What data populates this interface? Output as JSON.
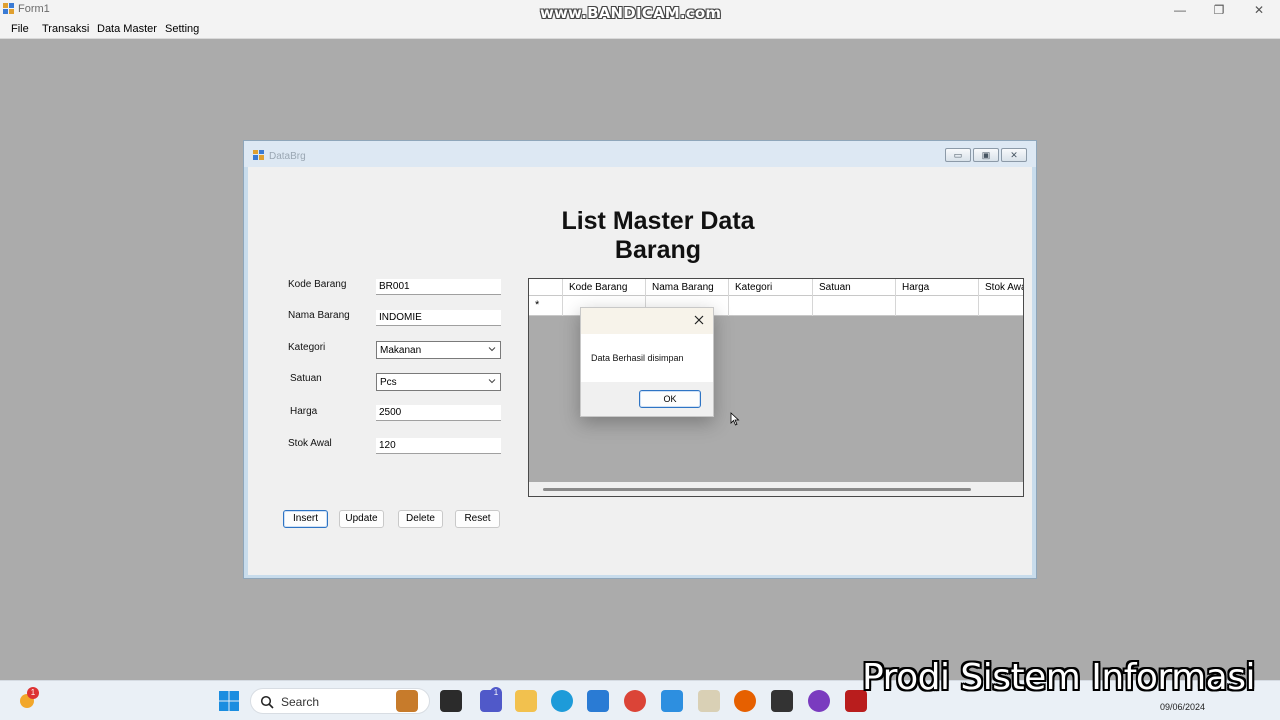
{
  "window": {
    "title": "Form1",
    "minimize": "—",
    "restore": "❐",
    "close": "✕"
  },
  "watermark": "www.BANDICAM.com",
  "menu": [
    "File",
    "Transaksi",
    "Data Master",
    "Setting"
  ],
  "child": {
    "title": "DataBrg",
    "heading": "List Master Data Barang",
    "fields": {
      "kode_label": "Kode Barang",
      "kode_value": "BR001",
      "nama_label": "Nama Barang",
      "nama_value": "INDOMIE",
      "kategori_label": "Kategori",
      "kategori_value": "Makanan",
      "satuan_label": "Satuan",
      "satuan_value": "Pcs",
      "harga_label": "Harga",
      "harga_value": "2500",
      "stok_label": "Stok Awal",
      "stok_value": "120"
    },
    "buttons": {
      "insert": "Insert",
      "update": "Update",
      "delete": "Delete",
      "reset": "Reset"
    },
    "grid": {
      "columns": [
        "Kode Barang",
        "Nama Barang",
        "Kategori",
        "Satuan",
        "Harga",
        "Stok Awal"
      ],
      "new_row_marker": "*"
    }
  },
  "messagebox": {
    "text": "Data Berhasil disimpan",
    "ok": "OK",
    "close": "✕"
  },
  "taskbar": {
    "search_placeholder": "Search",
    "date": "09/06/2024",
    "notification_count": "1",
    "teams_count": "1"
  },
  "overlay_caption": "Prodi Sistem Informasi",
  "colors": {
    "accent": "#2e74c4",
    "mdi_background": "#ababab",
    "child_frame": "#c8dcec"
  }
}
